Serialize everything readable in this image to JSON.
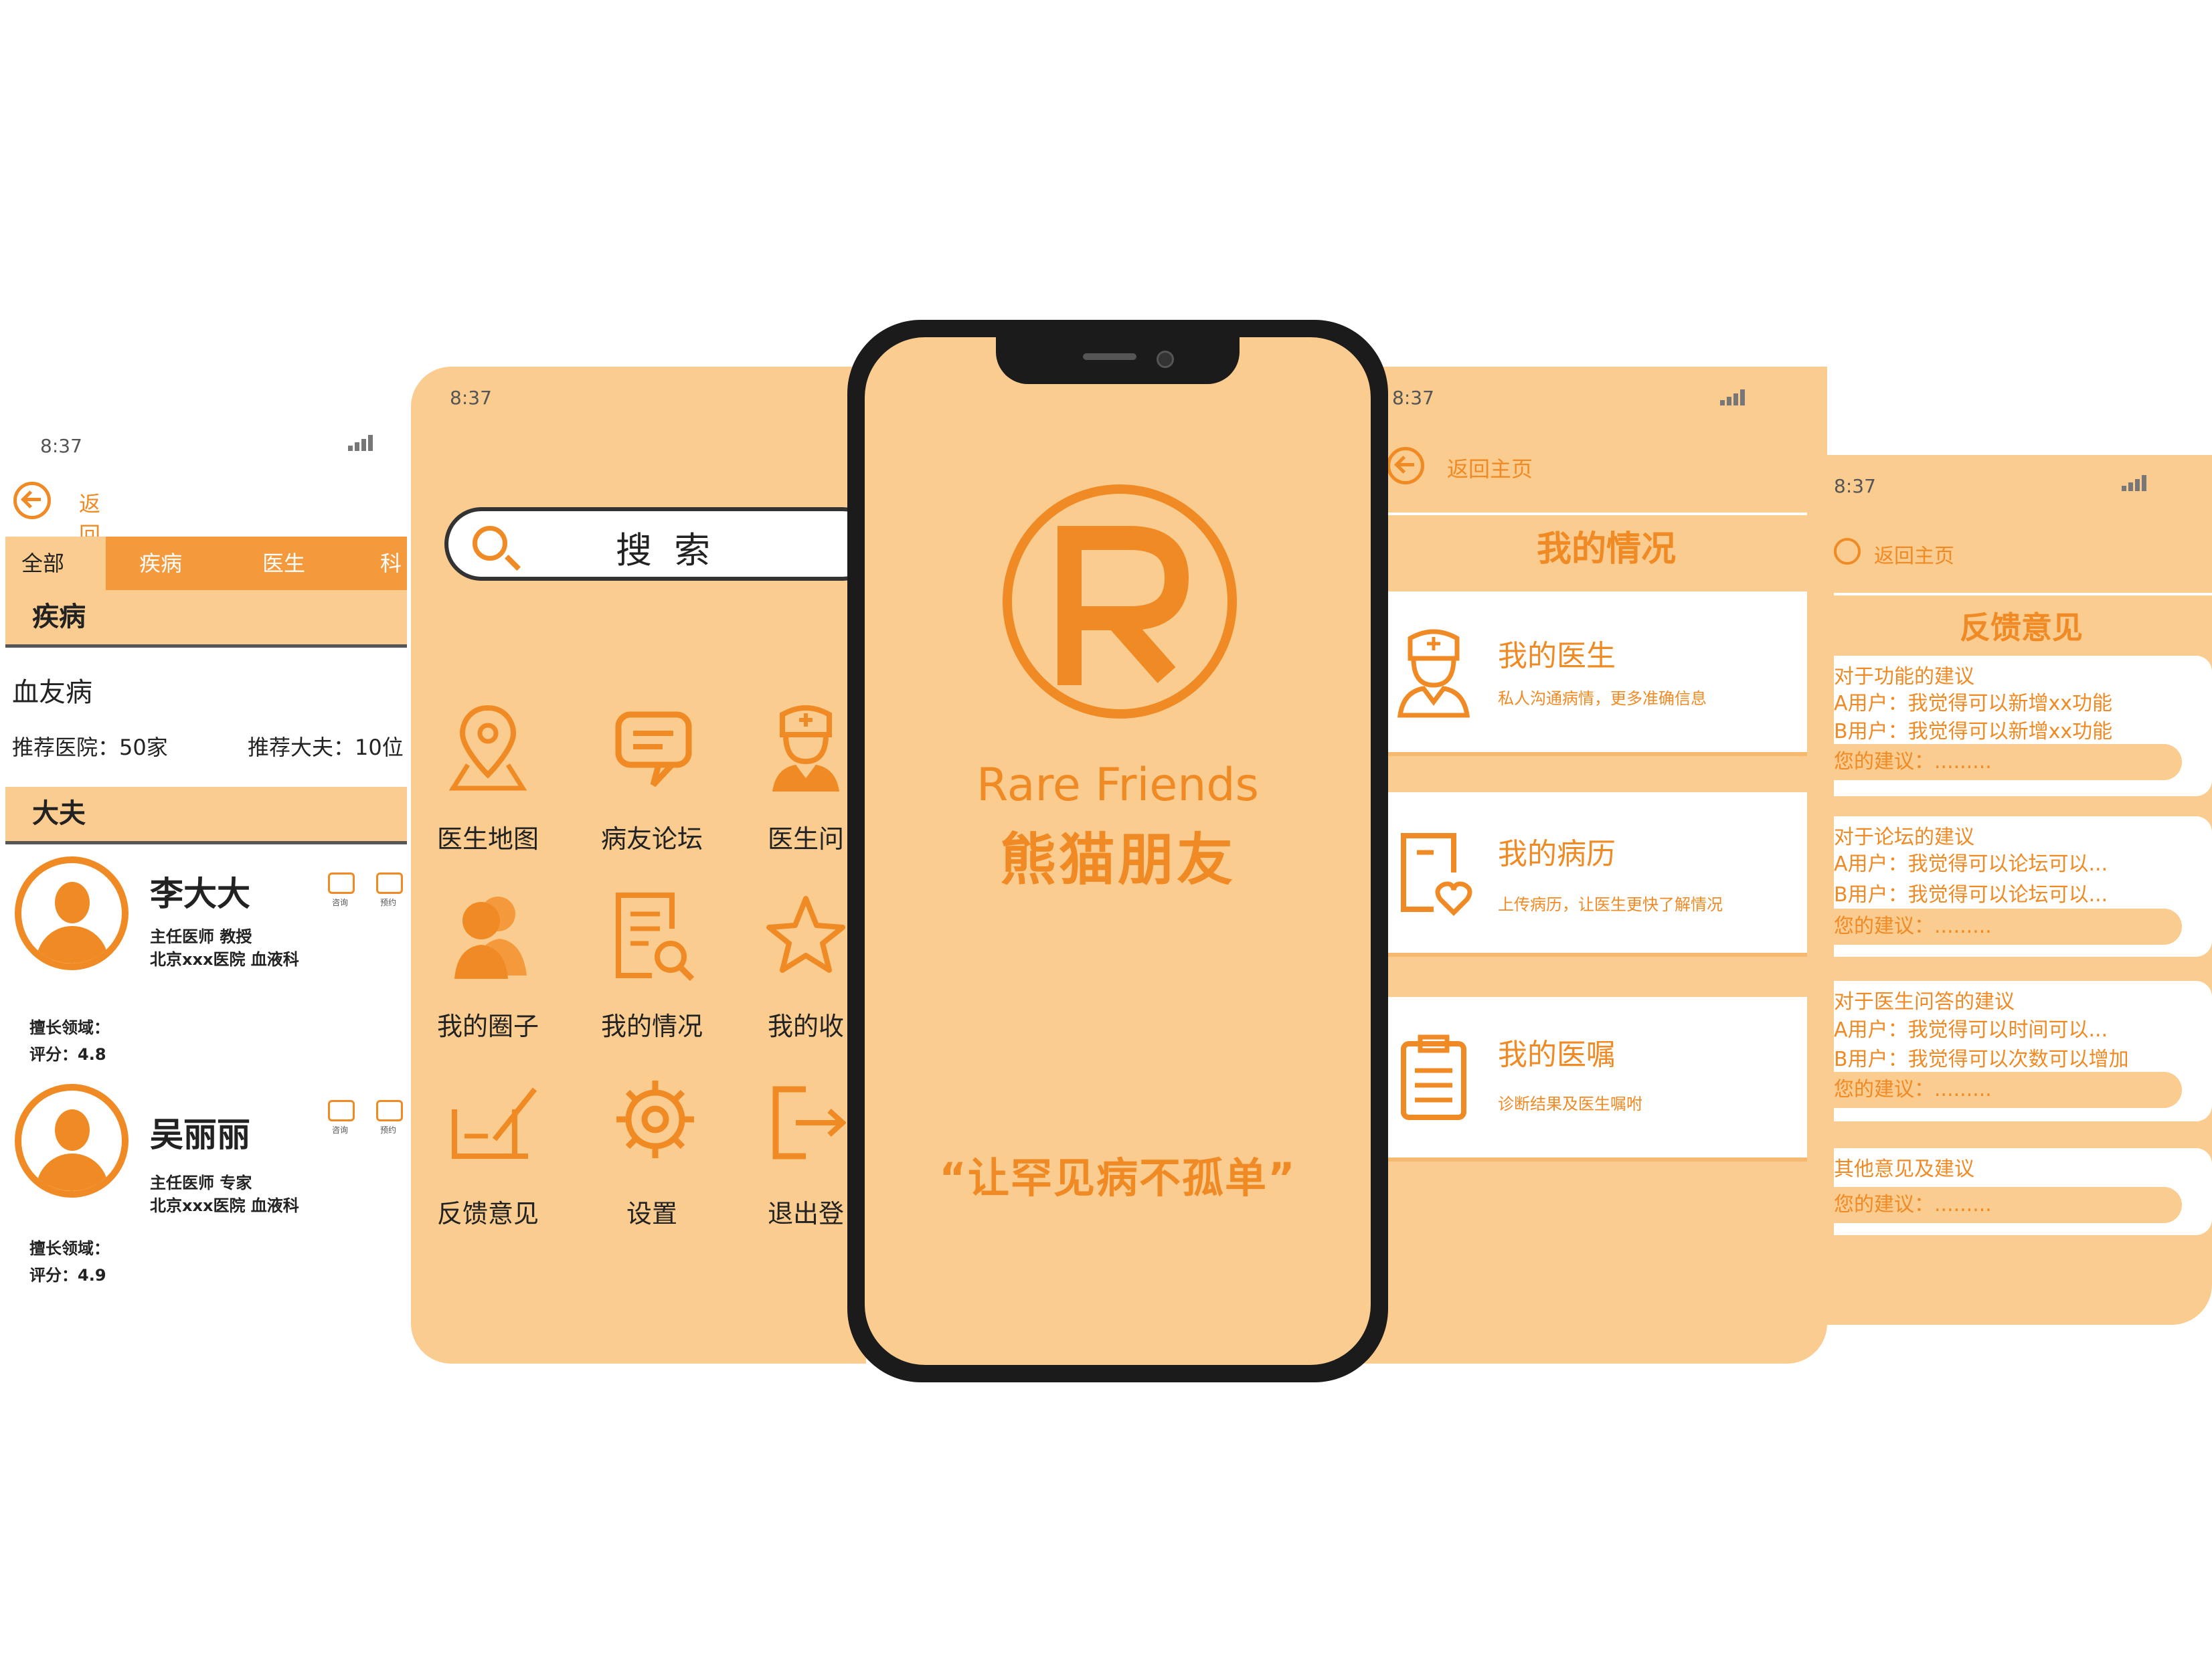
{
  "status": {
    "time": "8:37"
  },
  "panel_doctors": {
    "back_label": "返回地图",
    "tabs": [
      "全部",
      "疾病",
      "医生",
      "科"
    ],
    "section_disease": "疾病",
    "disease_name": "血友病",
    "rec_hospital": "推荐医院：50家",
    "rec_doctor": "推荐大夫：10位",
    "section_doctor": "大夫",
    "doctors": [
      {
        "name": "李大大",
        "title": "主任医师 教授",
        "hospital": "北京xxx医院 血液科",
        "field": "擅长领域：",
        "rating": "评分：4.8"
      },
      {
        "name": "吴丽丽",
        "title": "主任医师 专家",
        "hospital": "北京xxx医院 血液科",
        "field": "擅长领域：",
        "rating": "评分：4.9"
      }
    ],
    "icon_labels": [
      "咨询",
      "预约"
    ]
  },
  "panel_home": {
    "search_label": "搜 索",
    "grid": [
      {
        "label": "医生地图",
        "icon": "map-pin-icon"
      },
      {
        "label": "病友论坛",
        "icon": "chat-icon"
      },
      {
        "label": "医生问",
        "icon": "doctor-icon"
      },
      {
        "label": "我的圈子",
        "icon": "people-icon"
      },
      {
        "label": "我的情况",
        "icon": "document-search-icon"
      },
      {
        "label": "我的收",
        "icon": "star-icon"
      },
      {
        "label": "反馈意见",
        "icon": "edit-icon"
      },
      {
        "label": "设置",
        "icon": "gear-icon"
      },
      {
        "label": "退出登",
        "icon": "logout-icon"
      }
    ]
  },
  "splash": {
    "app_name_en": "Rare Friends",
    "app_name_cn": "熊猫朋友",
    "slogan": "“让罕见病不孤单”"
  },
  "panel_status": {
    "back_label": "返回主页",
    "title": "我的情况",
    "cards": [
      {
        "title": "我的医生",
        "subtitle": "私人沟通病情，更多准确信息",
        "icon": "doctor-icon"
      },
      {
        "title": "我的病历",
        "subtitle": "上传病历，让医生更快了解情况",
        "icon": "medical-record-icon"
      },
      {
        "title": "我的医嘱",
        "subtitle": "诊断结果及医生嘱咐",
        "icon": "clipboard-icon"
      }
    ]
  },
  "panel_feedback": {
    "back_label": "返回主页",
    "title": "反馈意见",
    "sections": [
      {
        "heading": "对于功能的建议",
        "lines": [
          "A用户：我觉得可以新增xx功能",
          "B用户：我觉得可以新增xx功能"
        ],
        "input": "您的建议：........."
      },
      {
        "heading": "对于论坛的建议",
        "lines": [
          "A用户：我觉得可以论坛可以...",
          "B用户：我觉得可以论坛可以..."
        ],
        "input": "您的建议：........."
      },
      {
        "heading": "对于医生问答的建议",
        "lines": [
          "A用户：我觉得可以时间可以...",
          "B用户：我觉得可以次数可以增加"
        ],
        "input": "您的建议：........."
      },
      {
        "heading": "其他意见及建议",
        "lines": [],
        "input": "您的建议：........."
      }
    ]
  },
  "colors": {
    "accent": "#f08a24",
    "background": "#fbcc8f",
    "frame": "#1b1b1b"
  }
}
